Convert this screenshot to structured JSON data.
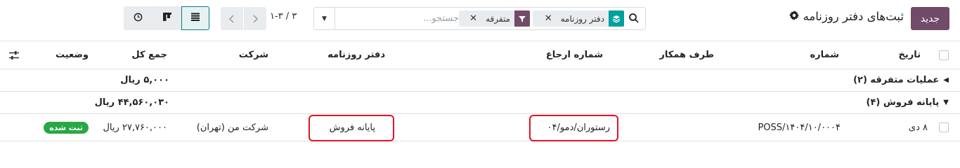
{
  "header": {
    "new_button": "جدید",
    "title": "ثبت‌های دفتر روزنامه",
    "title_icon": "gear-icon"
  },
  "search": {
    "placeholder": "جستجو...",
    "facets": [
      {
        "label": "دفتر روزنامه",
        "icon": "layers-icon",
        "color": "#00A09D"
      },
      {
        "label": "متفرقه",
        "icon": "filter-icon",
        "color": "#714B67"
      }
    ]
  },
  "pager": {
    "text": "۱-۳ / ۳"
  },
  "views": [
    "activity-view",
    "kanban-view",
    "list-view"
  ],
  "table": {
    "columns": [
      "تاریخ",
      "شماره",
      "طرف همکار",
      "شماره ارجاع",
      "دفتر روزنامه",
      "شرکت",
      "جمع کل",
      "وضعیت"
    ],
    "groups": [
      {
        "label": "عملیات متفرقه (۲)",
        "expanded": false,
        "total": "۵,۰۰۰ ریال"
      },
      {
        "label": "پایانه فروش (۴)",
        "expanded": true,
        "total": "۴۴,۵۶۰,۰۳۰ ریال"
      }
    ],
    "rows": [
      {
        "date": "۸ دی",
        "number": "POSS/۱۴۰۴/۱۰/۰۰۰۴",
        "partner": "",
        "reference": "رستوران/دمو/۰۴",
        "journal": "پایانه فروش",
        "company": "شرکت من (تهران)",
        "total": "۲۷,۷۶۰,۰۰۰ ریال",
        "status": "ثبت شده"
      }
    ]
  },
  "colors": {
    "primary": "#714B67",
    "teal": "#00A09D",
    "success": "#28a745",
    "highlight": "#e0141e"
  }
}
